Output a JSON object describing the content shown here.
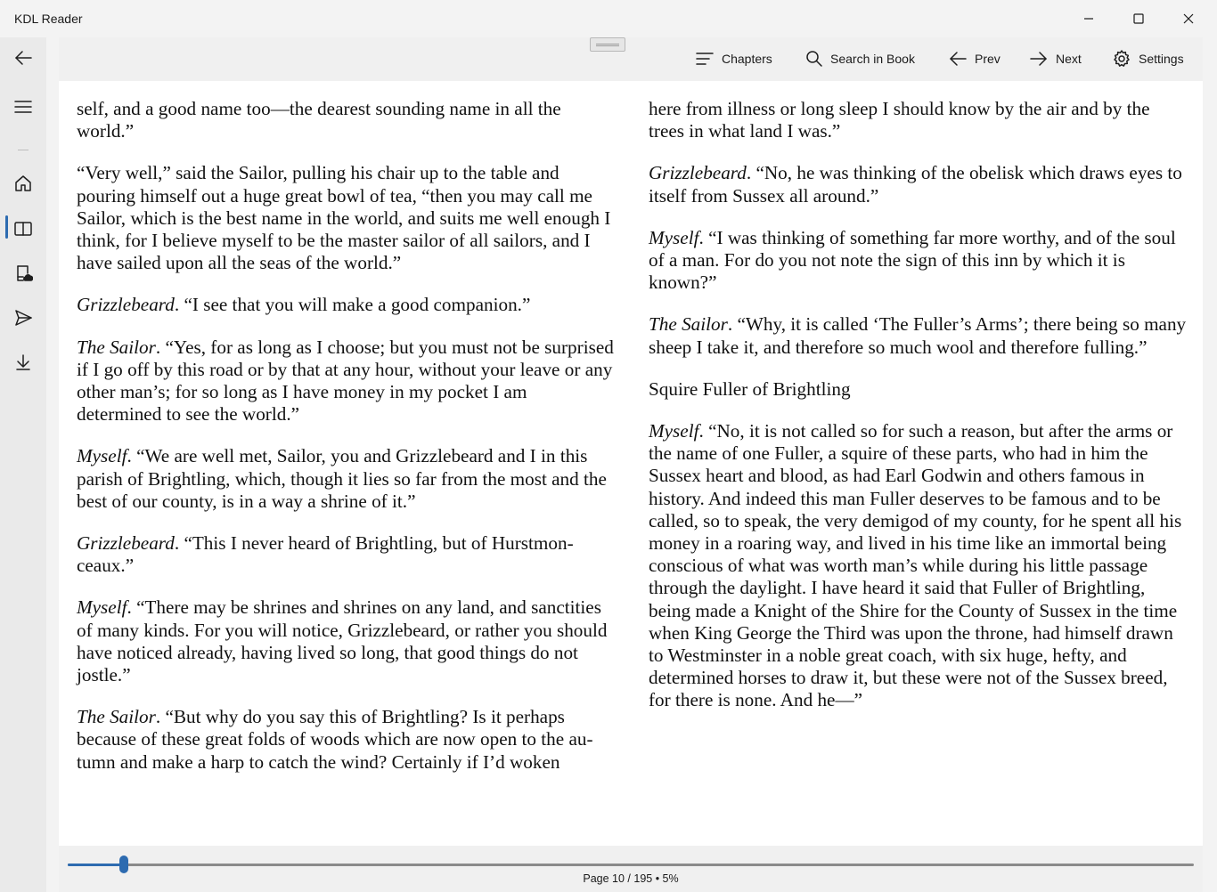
{
  "window": {
    "title": "KDL Reader",
    "controls": [
      "minimize",
      "maximize",
      "close"
    ]
  },
  "nav": {
    "items": [
      {
        "icon": "back-arrow-icon"
      },
      {
        "icon": "hamburger-icon"
      },
      {
        "icon": "home-icon"
      },
      {
        "icon": "book-open-icon",
        "active": true
      },
      {
        "icon": "library-cloud-icon"
      },
      {
        "icon": "send-icon"
      },
      {
        "icon": "download-icon"
      }
    ],
    "accent": "#2d6bb0"
  },
  "toolbar": {
    "chapters_label": "Chapters",
    "search_label": "Search in Book",
    "prev_label": "Prev",
    "next_label": "Next",
    "settings_label": "Settings"
  },
  "book": {
    "left": [
      {
        "speaker": "",
        "text": "self, and a good name too—the dearest sounding name in all the world.”"
      },
      {
        "speaker": "",
        "text": "“Very well,” said the Sailor, pulling his chair up to the table and pouring himself out a huge great bowl of tea, “then you may call me Sailor, which is the best name in the world, and suits me well enough I think, for I believe myself to be the master sailor of all sailors, and I have sailed upon all the seas of the world.”"
      },
      {
        "speaker": "Grizzlebeard",
        "text": ". “I see that you will make a good companion.”"
      },
      {
        "speaker": "The Sailor",
        "text": ". “Yes, for as long as I choose; but you must not be sur­prised if I go off by this road or by that at any hour, without your leave or any other man’s; for so long as I have money in my pocket I am determined to see the world.”"
      },
      {
        "speaker": "Myself",
        "text": ". “We are well met, Sailor, you and Grizzlebeard and I in this parish of Brightling, which, though it lies so far from the most and the best of our county, is in a way a shrine of it.”"
      },
      {
        "speaker": "Grizzlebeard",
        "text": ". “This I never heard of Brightling, but of Hurstmon­ceaux.”"
      },
      {
        "speaker": "Myself",
        "text": ". “There may be shrines and shrines on any land, and sanctit­ies of many kinds. For you will notice, Grizzlebeard, or rather you should have noticed already, having lived so long, that good things do not jostle.”"
      },
      {
        "speaker": "The Sailor",
        "text": ". “But why do you say this of Brightling? Is it perhaps because of these great folds of woods which are now open to the au­tumn and make a harp to catch the wind? Certainly if I’d woken"
      }
    ],
    "right": [
      {
        "speaker": "",
        "text": "here from illness or long sleep I should know by the air and by the trees in what land I was.”"
      },
      {
        "speaker": "Grizzlebeard",
        "text": ". “No, he was thinking of the obelisk which draws eyes to itself from Sussex all around.”"
      },
      {
        "speaker": "Myself",
        "text": ". “I was thinking of something far more worthy, and of the soul of a man. For do you not note the sign of this inn by which it is known?”"
      },
      {
        "speaker": "The Sailor",
        "text": ". “Why, it is called ‘The Fuller’s Arms’; there being so many sheep I take it, and therefore so much wool and therefore fulling.”"
      },
      {
        "speaker": "",
        "text": "Squire Fuller of Brightling"
      },
      {
        "speaker": "Myself",
        "text": ". “No, it is not called so for such a reason, but after the arms or the name of one Fuller, a squire of these parts, who had in him the Sussex heart and blood, as had Earl Godwin and others famous in history. And indeed this man Fuller deserves to be famous and to be called, so to speak, the very demigod of my county, for he spent all his money in a roaring way, and lived in his time like an immor­tal being conscious of what was worth man’s while during his little passage through the daylight. I have heard it said that Fuller of Brightling, being made a Knight of the Shire for the County of Sus­sex in the time when King George the Third was upon the throne, had himself drawn to Westminster in a noble great coach, with six huge, hefty, and determined horses to draw it, but these were not of the Sussex breed, for there is none. And he—”"
      }
    ]
  },
  "progress": {
    "status": "Page 10 / 195 • 5%",
    "fraction": 0.05
  }
}
